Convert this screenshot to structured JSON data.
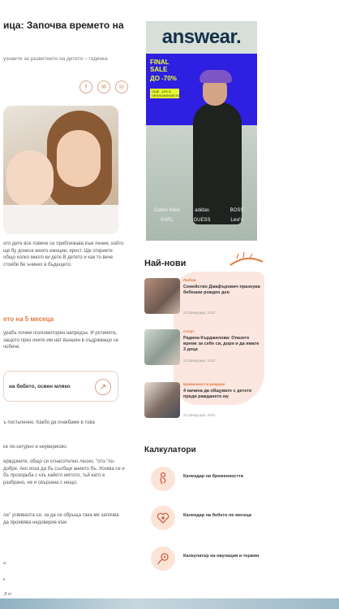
{
  "article": {
    "title": "ица: Започва времето на",
    "subtitle": "узнаете за развитието на детето – годинка",
    "para1": "ото дете все повече се приближава към ление, който ще бу донесе много емоции, ярост. Ще откриете общо колко много ки дете В детето и как то вече стоебв бе ъчинко в бъдещето.",
    "section_heading": "ето на 5 месеца",
    "para2": "урабъ почем психомоторен напредък. И ротииите, защото през очите им нат външен в оъдржващо се чобече.",
    "card_label": "на бебето, освен мляко",
    "para3": "ъ постьпенно. Какбо да очакбаме в това",
    "para4": "ке по-сигурно и неуверисмо.",
    "para5": "ерждзните, общо си отнасотелно лесно, \"ото-\"по-добре. Ако иска да бъ съобщи анието бъ. Усиква се и бъ прозорьба с кзъ кайето мятото, тьй като е разбрано, не и свързана с нещо;",
    "para6": "ла\" усвиваота си, за да се обрьща така ме започва да проявява недоверие към",
    "tail1": "а",
    "tail2": "к",
    "tail3": ",8 кг"
  },
  "share_icons": [
    "facebook-icon",
    "messenger-icon",
    "viber-icon"
  ],
  "ad": {
    "brand": "answear.",
    "sale_line1": "FINAL SALE",
    "sale_line2": "ДО -70%",
    "sale_line3": "ОЩЕ -10% В ПРИЛОЖЕНИЕТО",
    "logos": [
      "Calvin Klein",
      "adidas",
      "BOSS",
      "KARL",
      "GUESS",
      "Levi's"
    ]
  },
  "latest": {
    "heading": "Най-нови",
    "items": [
      {
        "category": "Любов",
        "title": "Семейство Джафърович празнува бебешки рожден ден",
        "date": "22 февруари, 2022"
      },
      {
        "category": "Спорт",
        "title": "Радина Кърджилова: Опазете време за себе си, дори и да имате 3 деца",
        "date": "22 февруари, 2022"
      },
      {
        "category": "Бременност и раждане",
        "title": "4 начина да общувате с детето преди раждането му",
        "date": "22 февруари, 2022"
      }
    ]
  },
  "calculators": {
    "heading": "Калкулатори",
    "items": [
      {
        "label": "Календар на бременността",
        "icon": "pregnant-icon"
      },
      {
        "label": "Календар на бебето по месеци",
        "icon": "heart-baby-icon"
      },
      {
        "label": "Калкулатор на овулация и термин",
        "icon": "ovulation-icon"
      }
    ]
  },
  "colors": {
    "accent": "#e2783f",
    "peach": "#fbe7df",
    "ad_blue": "#2f1fe0",
    "sale_yellow": "#e9ff31"
  }
}
